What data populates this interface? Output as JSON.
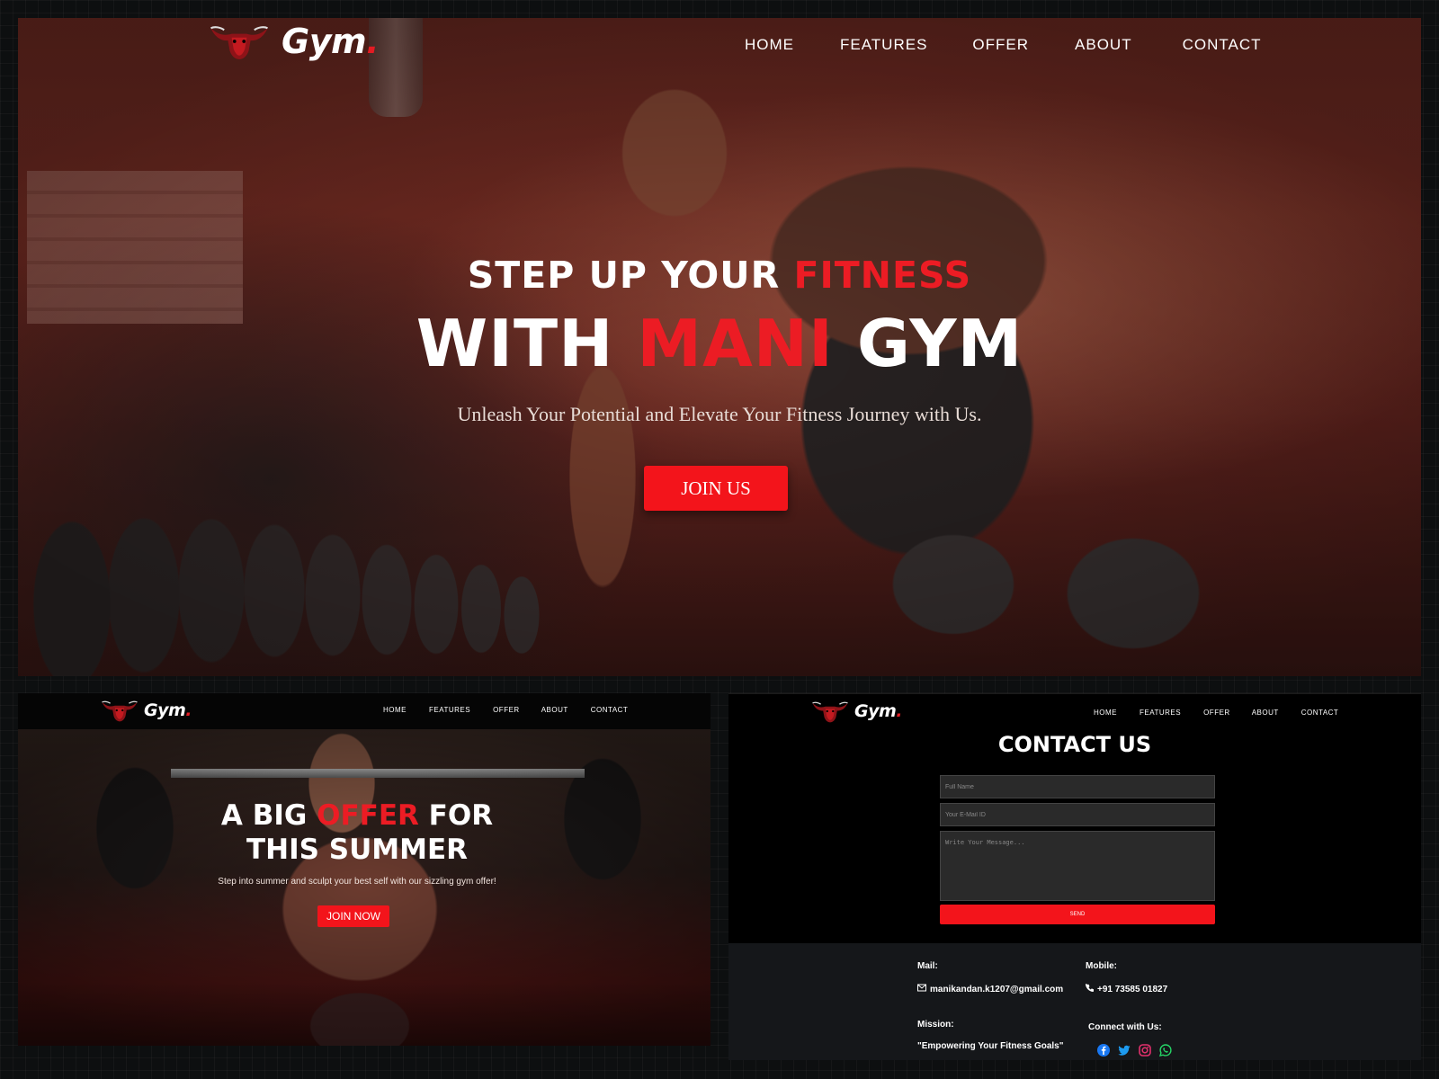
{
  "brand": {
    "name": "Gym",
    "dot": "."
  },
  "nav": [
    "HOME",
    "FEATURES",
    "OFFER",
    "ABOUT",
    "CONTACT"
  ],
  "hero": {
    "line1_pre": "STEP UP YOUR ",
    "line1_accent": "FITNESS",
    "line2_pre": "WITH ",
    "line2_accent": "MANI",
    "line2_post": " GYM",
    "tagline": "Unleash Your Potential and Elevate Your Fitness Journey with Us.",
    "cta": "JOIN US"
  },
  "offer": {
    "line1_pre": "A BIG ",
    "line1_accent": "OFFER",
    "line1_post": " FOR",
    "line2": "THIS SUMMER",
    "subtitle": "Step into summer and sculpt your best self with our sizzling gym offer!",
    "cta": "JOIN NOW"
  },
  "contact": {
    "title": "CONTACT US",
    "name_placeholder": "Full Name",
    "email_placeholder": "Your E-Mail ID",
    "message_placeholder": "Write Your Message...",
    "send": "SEND",
    "mail_label": "Mail:",
    "mail_value": "manikandan.k1207@gmail.com",
    "mobile_label": "Mobile:",
    "mobile_value": "+91 73585 01827",
    "mission_label": "Mission:",
    "mission_value": "\"Empowering Your Fitness Goals\"",
    "connect_label": "Connect with Us:",
    "social_icons": [
      "facebook-icon",
      "twitter-icon",
      "instagram-icon",
      "whatsapp-icon"
    ]
  },
  "colors": {
    "accent": "#ec1c24",
    "button": "#f3141b",
    "footer": "#15171a"
  }
}
